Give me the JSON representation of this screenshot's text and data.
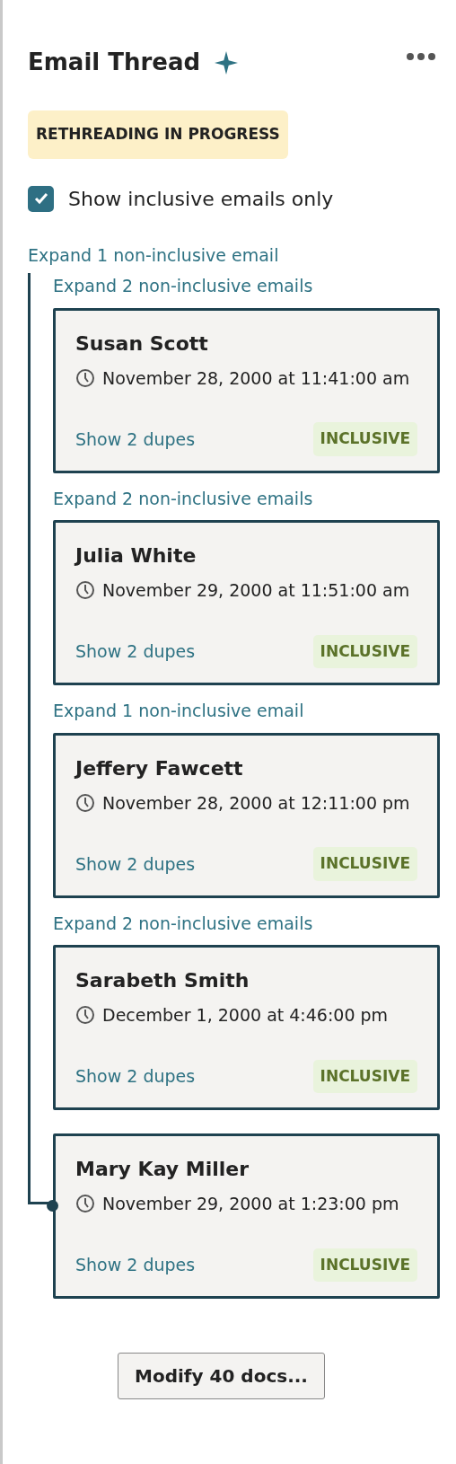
{
  "panel": {
    "title": "Email Thread",
    "status_badge": "RETHREADING IN PROGRESS"
  },
  "filter": {
    "label": "Show inclusive emails only",
    "checked": true
  },
  "top_expand": "Expand 1 non-inclusive email",
  "thread": [
    {
      "expand": "Expand 2 non-inclusive emails",
      "sender": "Susan Scott",
      "date": "November 28, 2000 at 11:41:00 am",
      "dupes": "Show 2 dupes",
      "tag": "INCLUSIVE"
    },
    {
      "expand": "Expand 2 non-inclusive emails",
      "sender": "Julia White",
      "date": "November 29, 2000 at 11:51:00 am",
      "dupes": "Show 2 dupes",
      "tag": "INCLUSIVE"
    },
    {
      "expand": "Expand 1 non-inclusive email",
      "sender": "Jeffery Fawcett",
      "date": "November 28, 2000 at 12:11:00 pm",
      "dupes": "Show 2 dupes",
      "tag": "INCLUSIVE"
    },
    {
      "expand": "Expand 2 non-inclusive emails",
      "sender": "Sarabeth Smith",
      "date": "December 1, 2000 at 4:46:00 pm",
      "dupes": "Show 2 dupes",
      "tag": "INCLUSIVE"
    },
    {
      "sender": "Mary Kay Miller",
      "date": "November 29, 2000 at 1:23:00 pm",
      "dupes": "Show 2 dupes",
      "tag": "INCLUSIVE"
    }
  ],
  "footer_button": "Modify 40 docs..."
}
